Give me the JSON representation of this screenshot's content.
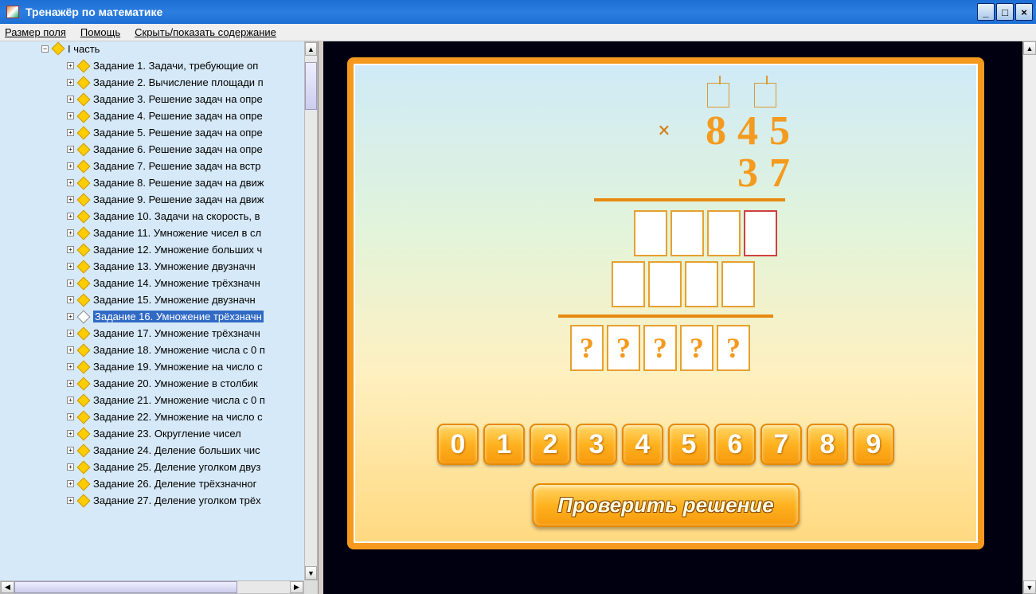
{
  "window": {
    "title": "Тренажёр по математике"
  },
  "menu": {
    "size": "Размер поля",
    "help": "Помощь",
    "toggle": "Скрыть/показать содержание"
  },
  "tree": {
    "root": "I часть",
    "items": [
      "Задание 1. Задачи, требующие оп",
      "Задание 2. Вычисление площади п",
      "Задание 3. Решение задач на опре",
      "Задание 4. Решение задач на опре",
      "Задание 5. Решение задач на опре",
      "Задание 6. Решение задач на опре",
      "Задание 7. Решение задач на встр",
      "Задание 8. Решение задач на движ",
      "Задание 9. Решение задач на движ",
      "Задание 10. Задачи на скорость, в",
      "Задание 11. Умножение чисел в сл",
      "Задание 12. Умножение больших ч",
      "Задание 13. Умножение двузначн",
      "Задание 14. Умножение трёхзначн",
      "Задание 15. Умножение двузначн",
      "Задание 16. Умножение трёхзначн",
      "Задание 17. Умножение трёхзначн",
      "Задание 18. Умножение числа с 0 п",
      "Задание 19. Умножение на число с",
      "Задание 20. Умножение в столбик",
      "Задание 21. Умножение числа с 0 п",
      "Задание 22. Умножение на число с",
      "Задание 23. Округление чисел",
      "Задание 24. Деление больших чис",
      "Задание 25. Деление уголком двуз",
      "Задание 26. Деление трёхзначног",
      "Задание 27. Деление уголком трёх"
    ],
    "selected_index": 15
  },
  "exercise": {
    "multiplicand": [
      "8",
      "4",
      "5"
    ],
    "multiplier": [
      "3",
      "7"
    ],
    "mult_sign": "×",
    "partial_rows": [
      {
        "cells": 4,
        "active_last": true
      },
      {
        "cells": 4,
        "active_last": false
      }
    ],
    "result_cells": 5,
    "result_placeholder": "?",
    "digits": [
      "0",
      "1",
      "2",
      "3",
      "4",
      "5",
      "6",
      "7",
      "8",
      "9"
    ],
    "check_label": "Проверить решение"
  }
}
